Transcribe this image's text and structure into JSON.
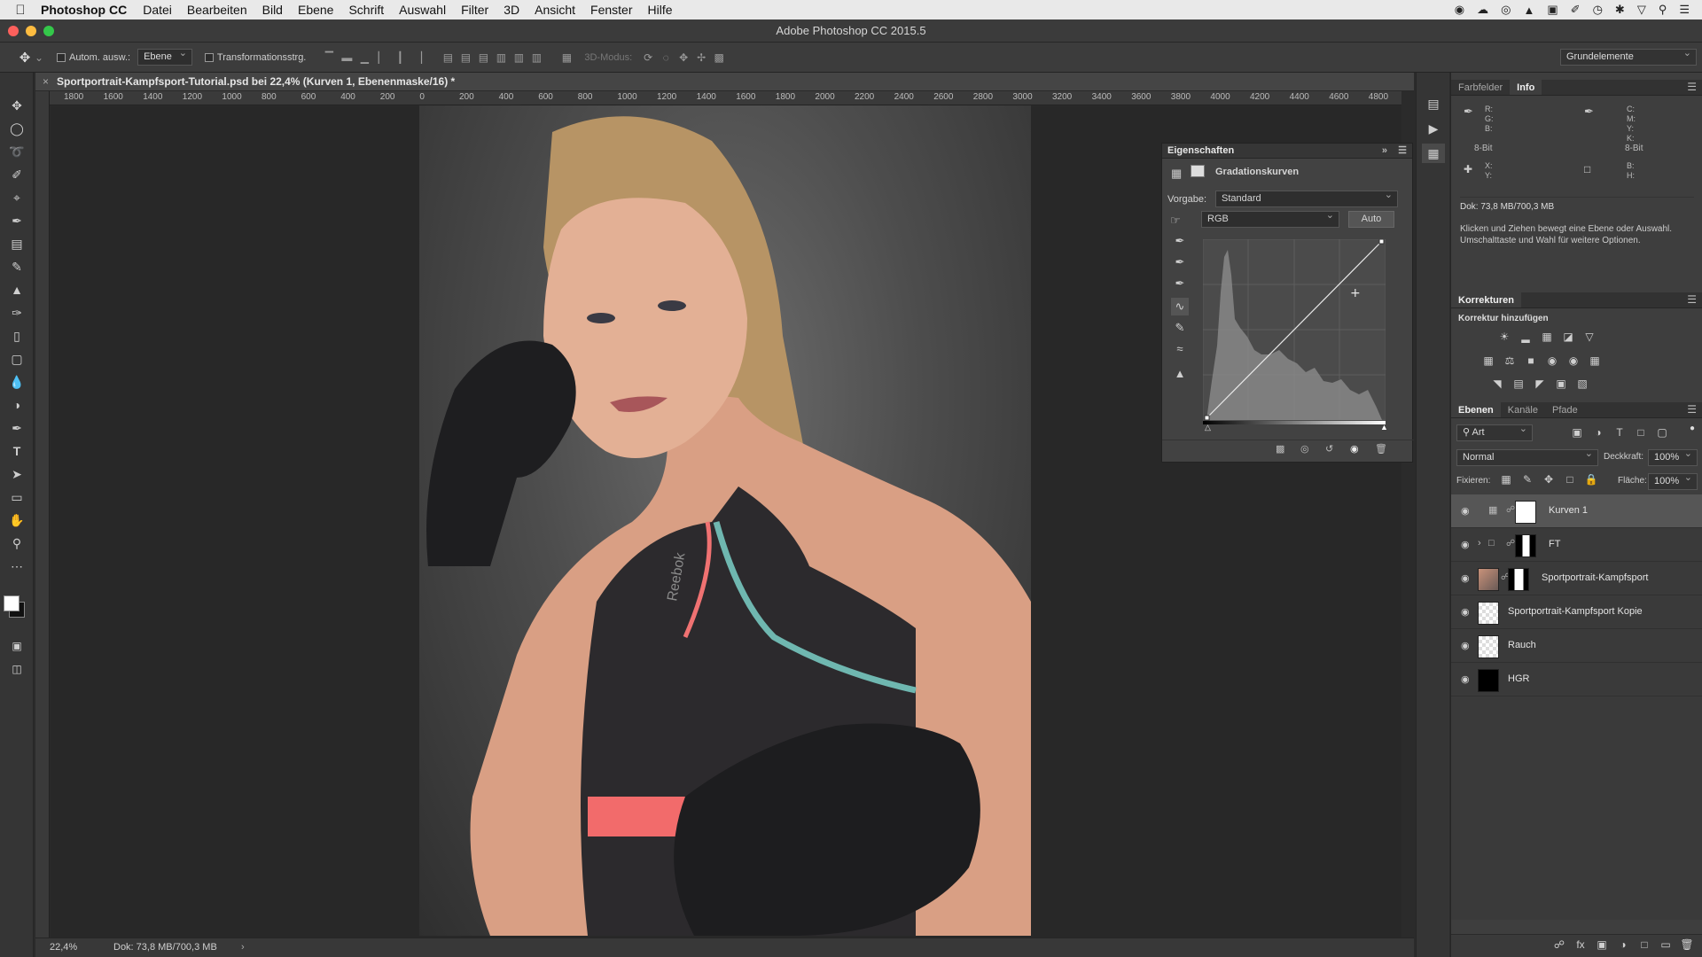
{
  "menubar": {
    "app_name": "Photoshop CC",
    "items": [
      "Datei",
      "Bearbeiten",
      "Bild",
      "Ebene",
      "Schrift",
      "Auswahl",
      "Filter",
      "3D",
      "Ansicht",
      "Fenster",
      "Hilfe"
    ]
  },
  "window": {
    "title": "Adobe Photoshop CC 2015.5"
  },
  "options_bar": {
    "auto_select_label": "Autom. ausw.:",
    "auto_select_value": "Ebene",
    "transform_label": "Transformationsstrg.",
    "mode_3d_label": "3D-Modus:",
    "workspace": "Grundelemente"
  },
  "document": {
    "tab_title": "Sportportrait-Kampfsport-Tutorial.psd bei 22,4% (Kurven 1, Ebenenmaske/16) *",
    "ruler_labels": [
      "1800",
      "1600",
      "1400",
      "1200",
      "1000",
      "800",
      "600",
      "400",
      "200",
      "0",
      "200",
      "400",
      "600",
      "800",
      "1000",
      "1200",
      "1400",
      "1600",
      "1800",
      "2000",
      "2200",
      "2400",
      "2600",
      "2800",
      "3000",
      "3200",
      "3400",
      "3600",
      "3800",
      "4000",
      "4200",
      "4400",
      "4600",
      "4800"
    ],
    "zoom": "22,4%",
    "doc_size": "Dok: 73,8 MB/700,3 MB"
  },
  "properties": {
    "title": "Eigenschaften",
    "adjustment_name": "Gradationskurven",
    "preset_label": "Vorgabe:",
    "preset_value": "Standard",
    "channel_value": "RGB",
    "auto_button": "Auto"
  },
  "info_panel": {
    "tabs": [
      "Farbfelder",
      "Info"
    ],
    "rgb_labels": "R:\nG:\nB:",
    "cmyk_labels": "C:\nM:\nY:\nK:",
    "bit_left": "8-Bit",
    "bit_right": "8-Bit",
    "xy_labels": "X:\nY:",
    "wh_labels": "B:\nH:",
    "doc_size": "Dok: 73,8 MB/700,3 MB",
    "hint": "Klicken und Ziehen bewegt eine Ebene oder Auswahl. Umschalttaste und Wahl für weitere Optionen."
  },
  "corrections_panel": {
    "title": "Korrekturen",
    "subtitle": "Korrektur hinzufügen"
  },
  "layers_panel": {
    "tabs": [
      "Ebenen",
      "Kanäle",
      "Pfade"
    ],
    "filter_kind": "Art",
    "blend_mode": "Normal",
    "opacity_label": "Deckkraft:",
    "opacity_value": "100%",
    "lock_label": "Fixieren:",
    "fill_label": "Fläche:",
    "fill_value": "100%",
    "layers": [
      {
        "name": "Kurven 1",
        "selected": true
      },
      {
        "name": "FT",
        "selected": false
      },
      {
        "name": "Sportportrait-Kampfsport",
        "selected": false
      },
      {
        "name": "Sportportrait-Kampfsport Kopie",
        "selected": false
      },
      {
        "name": "Rauch",
        "selected": false
      },
      {
        "name": "HGR",
        "selected": false
      }
    ]
  },
  "photo": {
    "shirt_text": "Reebok"
  }
}
